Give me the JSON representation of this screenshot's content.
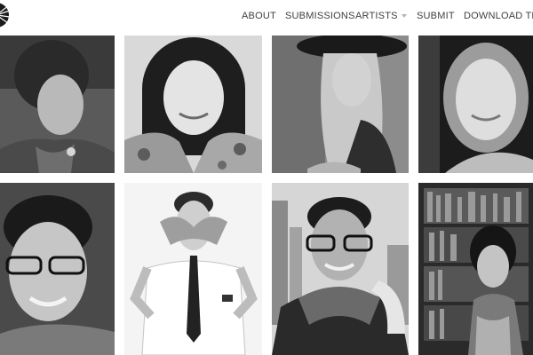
{
  "nav": {
    "about": "ABOUT",
    "submissions": "SUBMISSIONS",
    "artists": "ARTISTS",
    "submit": "SUBMIT",
    "download": "DOWNLOAD THE"
  },
  "icons": {
    "logo": "striped-fan-logo-icon",
    "artists_caret": "chevron-down-icon"
  },
  "grid": {
    "photo_style": "black-and-white portraits",
    "rows": [
      [
        "woman-dark-updo-portrait",
        "smiling-woman-floral-shirt-portrait",
        "woman-wide-brim-hat-portrait",
        "smiling-woman-long-hair-portrait"
      ],
      [
        "smiling-man-glasses-portrait",
        "man-covering-eyes-with-hands-portrait",
        "man-glasses-scarf-city-portrait",
        "woman-bookshelves-portrait"
      ]
    ]
  },
  "colors": {
    "background": "#ffffff",
    "nav_text": "#3f3f3f",
    "caret": "#b5b5b5"
  }
}
